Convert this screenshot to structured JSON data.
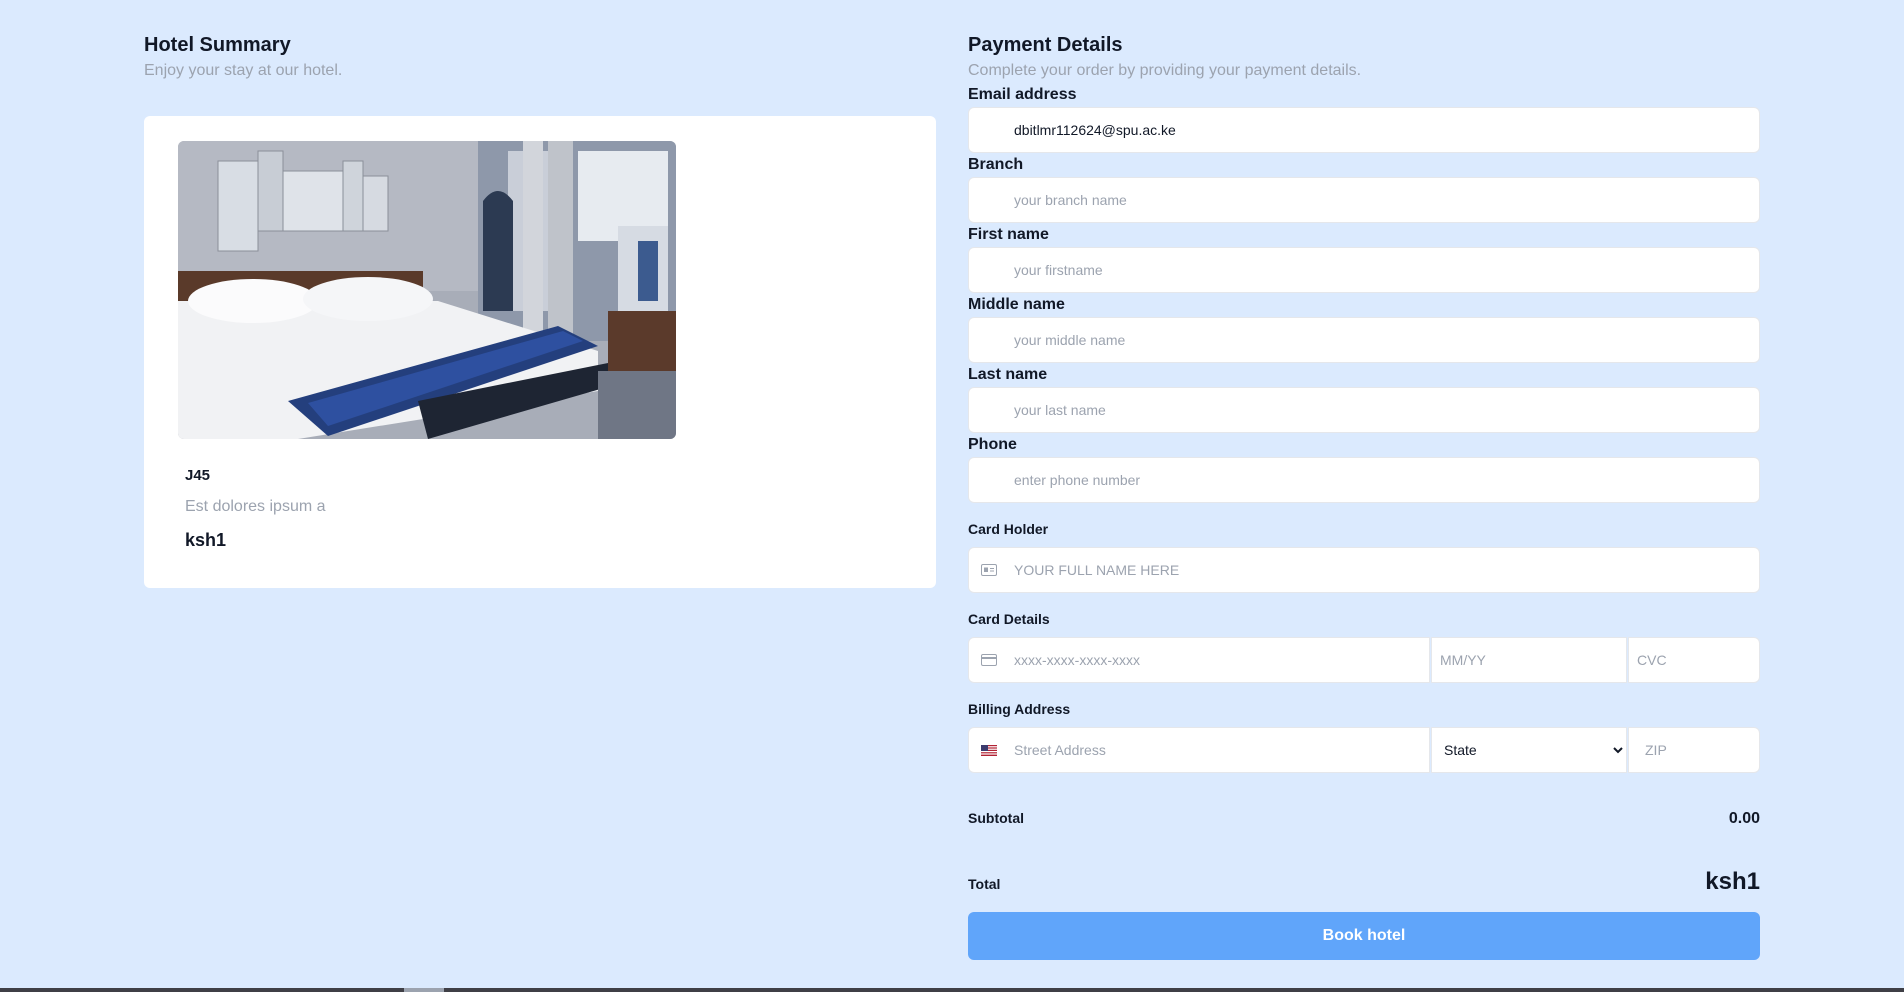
{
  "hotel_summary": {
    "title": "Hotel Summary",
    "subtitle": "Enjoy your stay at our hotel.",
    "room": {
      "code": "J45",
      "description": "Est dolores ipsum a",
      "price": "ksh1"
    }
  },
  "payment": {
    "title": "Payment Details",
    "subtitle": "Complete your order by providing your payment details.",
    "email": {
      "label": "Email address",
      "value": "dbitlmr112624@spu.ac.ke"
    },
    "branch": {
      "label": "Branch",
      "placeholder": "your branch name"
    },
    "first_name": {
      "label": "First name",
      "placeholder": "your firstname"
    },
    "middle_name": {
      "label": "Middle name",
      "placeholder": "your middle name"
    },
    "last_name": {
      "label": "Last name",
      "placeholder": "your last name"
    },
    "phone": {
      "label": "Phone",
      "placeholder": "enter phone number"
    },
    "card_holder": {
      "label": "Card Holder",
      "placeholder": "YOUR FULL NAME HERE",
      "icon": "id-card-icon"
    },
    "card_details": {
      "label": "Card Details",
      "number_placeholder": "xxxx-xxxx-xxxx-xxxx",
      "expiry_placeholder": "MM/YY",
      "cvc_placeholder": "CVC",
      "icon": "credit-card-icon"
    },
    "billing": {
      "label": "Billing Address",
      "street_placeholder": "Street Address",
      "state_selected": "State",
      "zip_placeholder": "ZIP",
      "icon": "us-flag-icon"
    },
    "subtotal": {
      "label": "Subtotal",
      "value": "0.00"
    },
    "total": {
      "label": "Total",
      "value": "ksh1"
    },
    "book_button": "Book hotel"
  },
  "colors": {
    "page_bg": "#dbeafe",
    "button": "#60a5fa",
    "muted_text": "#9ca3af"
  }
}
